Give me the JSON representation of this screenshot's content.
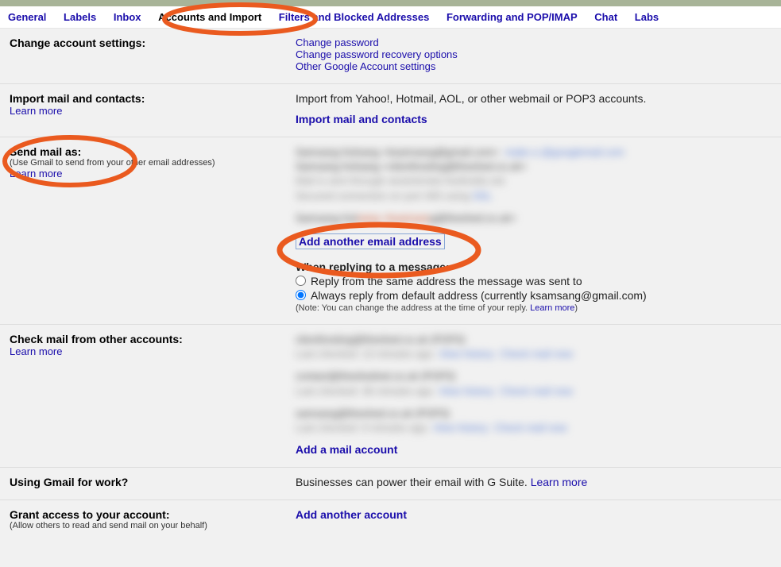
{
  "tabs": {
    "general": "General",
    "labels": "Labels",
    "inbox": "Inbox",
    "accounts": "Accounts and Import",
    "filters": "Filters and Blocked Addresses",
    "forwarding": "Forwarding and POP/IMAP",
    "chat": "Chat",
    "labs": "Labs"
  },
  "change_account": {
    "title": "Change account settings:",
    "change_password": "Change password",
    "change_recovery": "Change password recovery options",
    "other_settings": "Other Google Account settings"
  },
  "import_mail": {
    "title": "Import mail and contacts:",
    "learn_more": "Learn more",
    "desc": "Import from Yahoo!, Hotmail, AOL, or other webmail or POP3 accounts.",
    "action": "Import mail and contacts"
  },
  "send_mail_as": {
    "title": "Send mail as:",
    "sub": "(Use Gmail to send from your other email addresses)",
    "learn_more": "Learn more",
    "add_link": "Add another email address",
    "reply_heading": "When replying to a message:",
    "reply_same": "Reply from the same address the message was sent to",
    "reply_default": "Always reply from default address (currently ksamsang@gmail.com)",
    "note_prefix": "(Note: You can change the address at the time of your reply. ",
    "note_link": "Learn more",
    "note_suffix": ")",
    "blur1a": "Samsang Kelsang <ksamsang@gmail.com>",
    "blur1b": "make a @googlemail.com",
    "blur2": "Samsang Kelsang <clienthosting@theshed.co.uk>",
    "blur3": "Mail is sent through westminster.footholds.net",
    "blur4a": "Secured connection on port 465 using ",
    "blur4b": "SSL",
    "blur5a": "Samsang Kel",
    "blur5b": "sang <ksamsan",
    "blur5c": "g@theshed.co.uk>"
  },
  "check_mail": {
    "title": "Check mail from other accounts:",
    "learn_more": "Learn more",
    "action": "Add a mail account",
    "blur_r1a": "clienthosting@theshed.co.uk (POP3)",
    "blur_r1b": "Last checked: 13 minutes ago.  ",
    "blur_r1c": "View history",
    "blur_r1d": "Check mail now",
    "blur_r2a": "contact@theshednet.co.uk (POP3)",
    "blur_r2b": "Last checked: 36 minutes ago.  ",
    "blur_r3a": "samsang@theshed.co.uk (POP3)",
    "blur_r3b": "Last checked: 9 minutes ago.  "
  },
  "gmail_work": {
    "title": "Using Gmail for work?",
    "desc": "Businesses can power their email with G Suite. ",
    "learn_more": "Learn more"
  },
  "grant_access": {
    "title": "Grant access to your account:",
    "sub": "(Allow others to read and send mail on your behalf)",
    "action": "Add another account"
  }
}
